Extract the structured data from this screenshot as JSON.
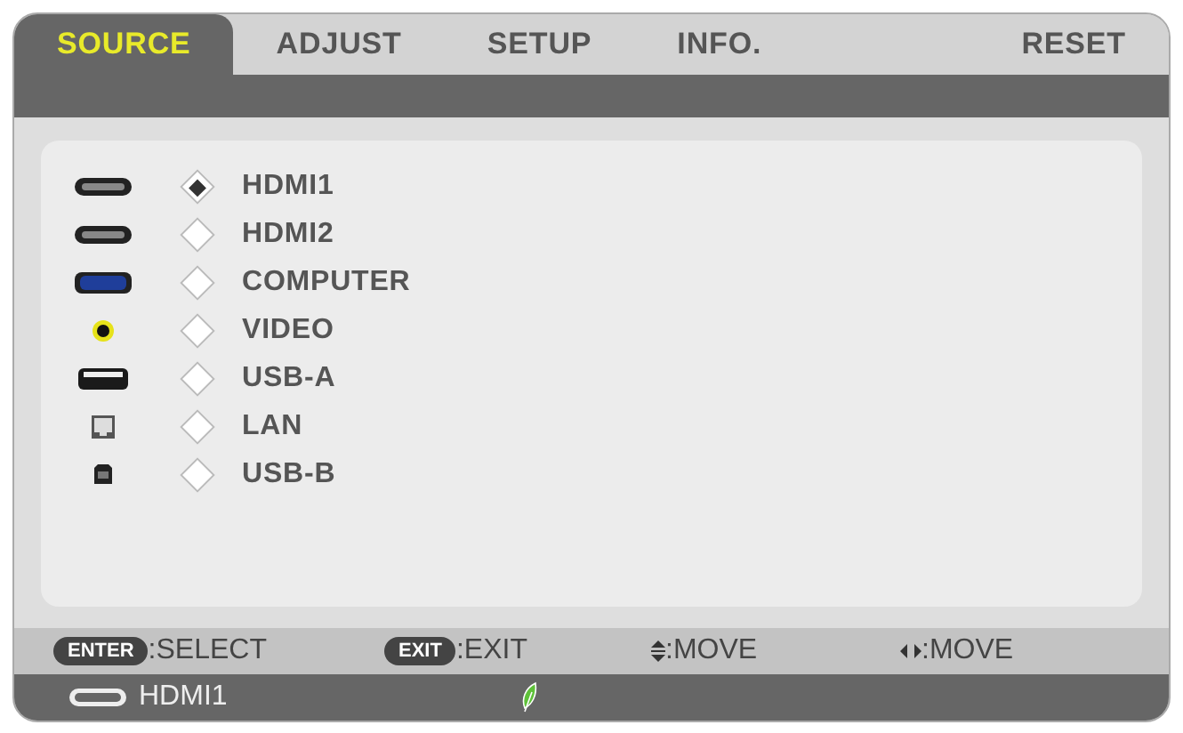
{
  "tabs": [
    {
      "label": "SOURCE",
      "selected": true
    },
    {
      "label": "ADJUST",
      "selected": false
    },
    {
      "label": "SETUP",
      "selected": false
    },
    {
      "label": "INFO.",
      "selected": false
    },
    {
      "label": "RESET",
      "selected": false
    }
  ],
  "inputs": [
    {
      "kind": "hdmi",
      "label": "HDMI1",
      "selected": true
    },
    {
      "kind": "hdmi",
      "label": "HDMI2",
      "selected": false
    },
    {
      "kind": "vga",
      "label": "COMPUTER",
      "selected": false
    },
    {
      "kind": "rca",
      "label": "VIDEO",
      "selected": false
    },
    {
      "kind": "usba",
      "label": "USB-A",
      "selected": false
    },
    {
      "kind": "lan",
      "label": "LAN",
      "selected": false
    },
    {
      "kind": "usbb",
      "label": "USB-B",
      "selected": false
    }
  ],
  "hints": [
    {
      "kind": "key",
      "key": "ENTER",
      "text": ":SELECT"
    },
    {
      "kind": "key",
      "key": "EXIT",
      "text": ":EXIT"
    },
    {
      "kind": "updown",
      "text": ":MOVE"
    },
    {
      "kind": "leftright",
      "text": ":MOVE"
    }
  ],
  "status_bar": {
    "source": "HDMI1",
    "eco": true
  }
}
